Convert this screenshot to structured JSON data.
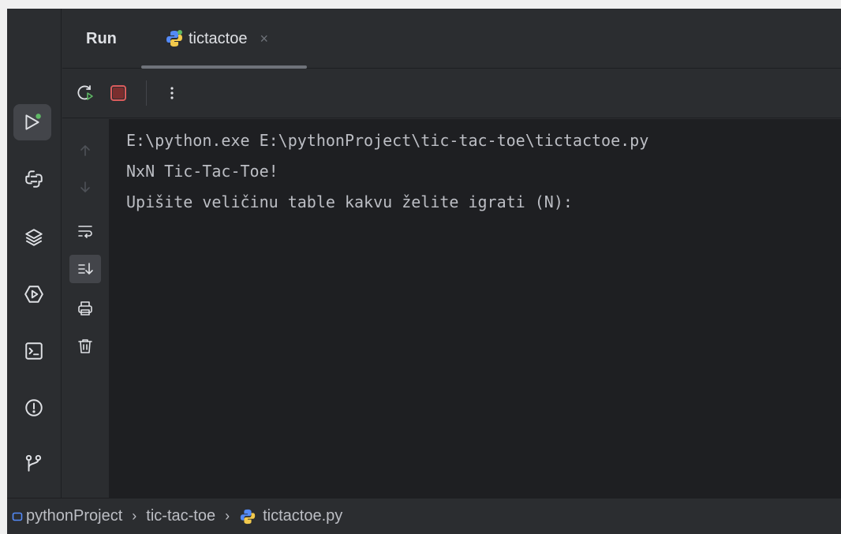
{
  "panel": {
    "title": "Run",
    "tab": {
      "label": "tictactoe",
      "close": "×",
      "icon": "python-file-icon"
    }
  },
  "toolstrip": [
    {
      "name": "run-tool",
      "icon": "run-icon",
      "active": true
    },
    {
      "name": "python-console-tool",
      "icon": "python-console-icon"
    },
    {
      "name": "python-packages-tool",
      "icon": "layers-icon"
    },
    {
      "name": "services-tool",
      "icon": "services-icon"
    },
    {
      "name": "terminal-tool",
      "icon": "terminal-icon"
    },
    {
      "name": "problems-tool",
      "icon": "problems-icon"
    },
    {
      "name": "git-tool",
      "icon": "git-branch-icon"
    }
  ],
  "actions": {
    "rerun": "rerun-icon",
    "stop": "stop-icon",
    "more": "more-vertical-icon"
  },
  "console_tools": [
    "up-arrow-icon",
    "down-arrow-icon",
    "soft-wrap-icon",
    "scroll-to-end-icon",
    "print-icon",
    "trash-icon"
  ],
  "console": {
    "lines": [
      "E:\\python.exe E:\\pythonProject\\tic-tac-toe\\tictactoe.py",
      "NxN Tic-Tac-Toe!",
      "Upišite veličinu table kakvu želite igrati (N):"
    ]
  },
  "breadcrumb": {
    "project": "pythonProject",
    "folder": "tic-tac-toe",
    "file": "tictactoe.py",
    "separator": "›"
  },
  "colors": {
    "background": "#2b2d30",
    "console_bg": "#1e1f22",
    "stop_red": "#db5c5c",
    "run_green": "#5fb865",
    "project_blue": "#548af7"
  }
}
